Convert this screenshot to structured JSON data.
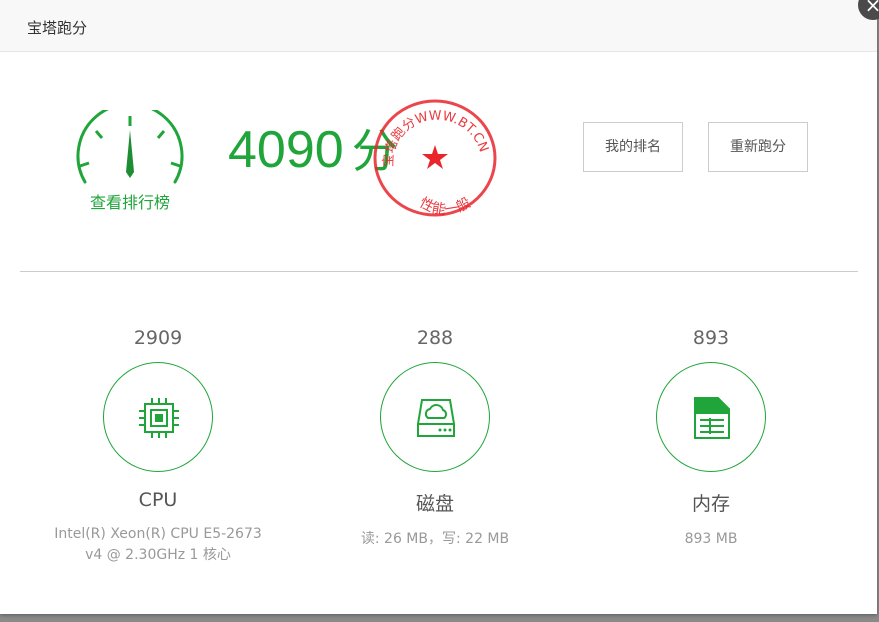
{
  "dialog": {
    "title": "宝塔跑分",
    "close_symbol": "×"
  },
  "summary": {
    "ranking_link": "查看排行榜",
    "total_score": "4090",
    "score_unit": "分",
    "stamp_text_top": "宝塔跑分WWW.BT.CN",
    "stamp_text_bottom": "性能一般",
    "my_rank_button": "我的排名",
    "retest_button": "重新跑分"
  },
  "metrics": [
    {
      "score": "2909",
      "name": "CPU",
      "detail": "Intel(R) Xeon(R) CPU E5-2673 v4 @ 2.30GHz 1 核心",
      "icon": "cpu-icon"
    },
    {
      "score": "288",
      "name": "磁盘",
      "detail": "读: 26 MB，写: 22 MB",
      "icon": "disk-icon"
    },
    {
      "score": "893",
      "name": "内存",
      "detail": "893 MB",
      "icon": "memory-icon"
    }
  ],
  "colors": {
    "accent": "#20a53a",
    "stamp": "#e8262b"
  }
}
